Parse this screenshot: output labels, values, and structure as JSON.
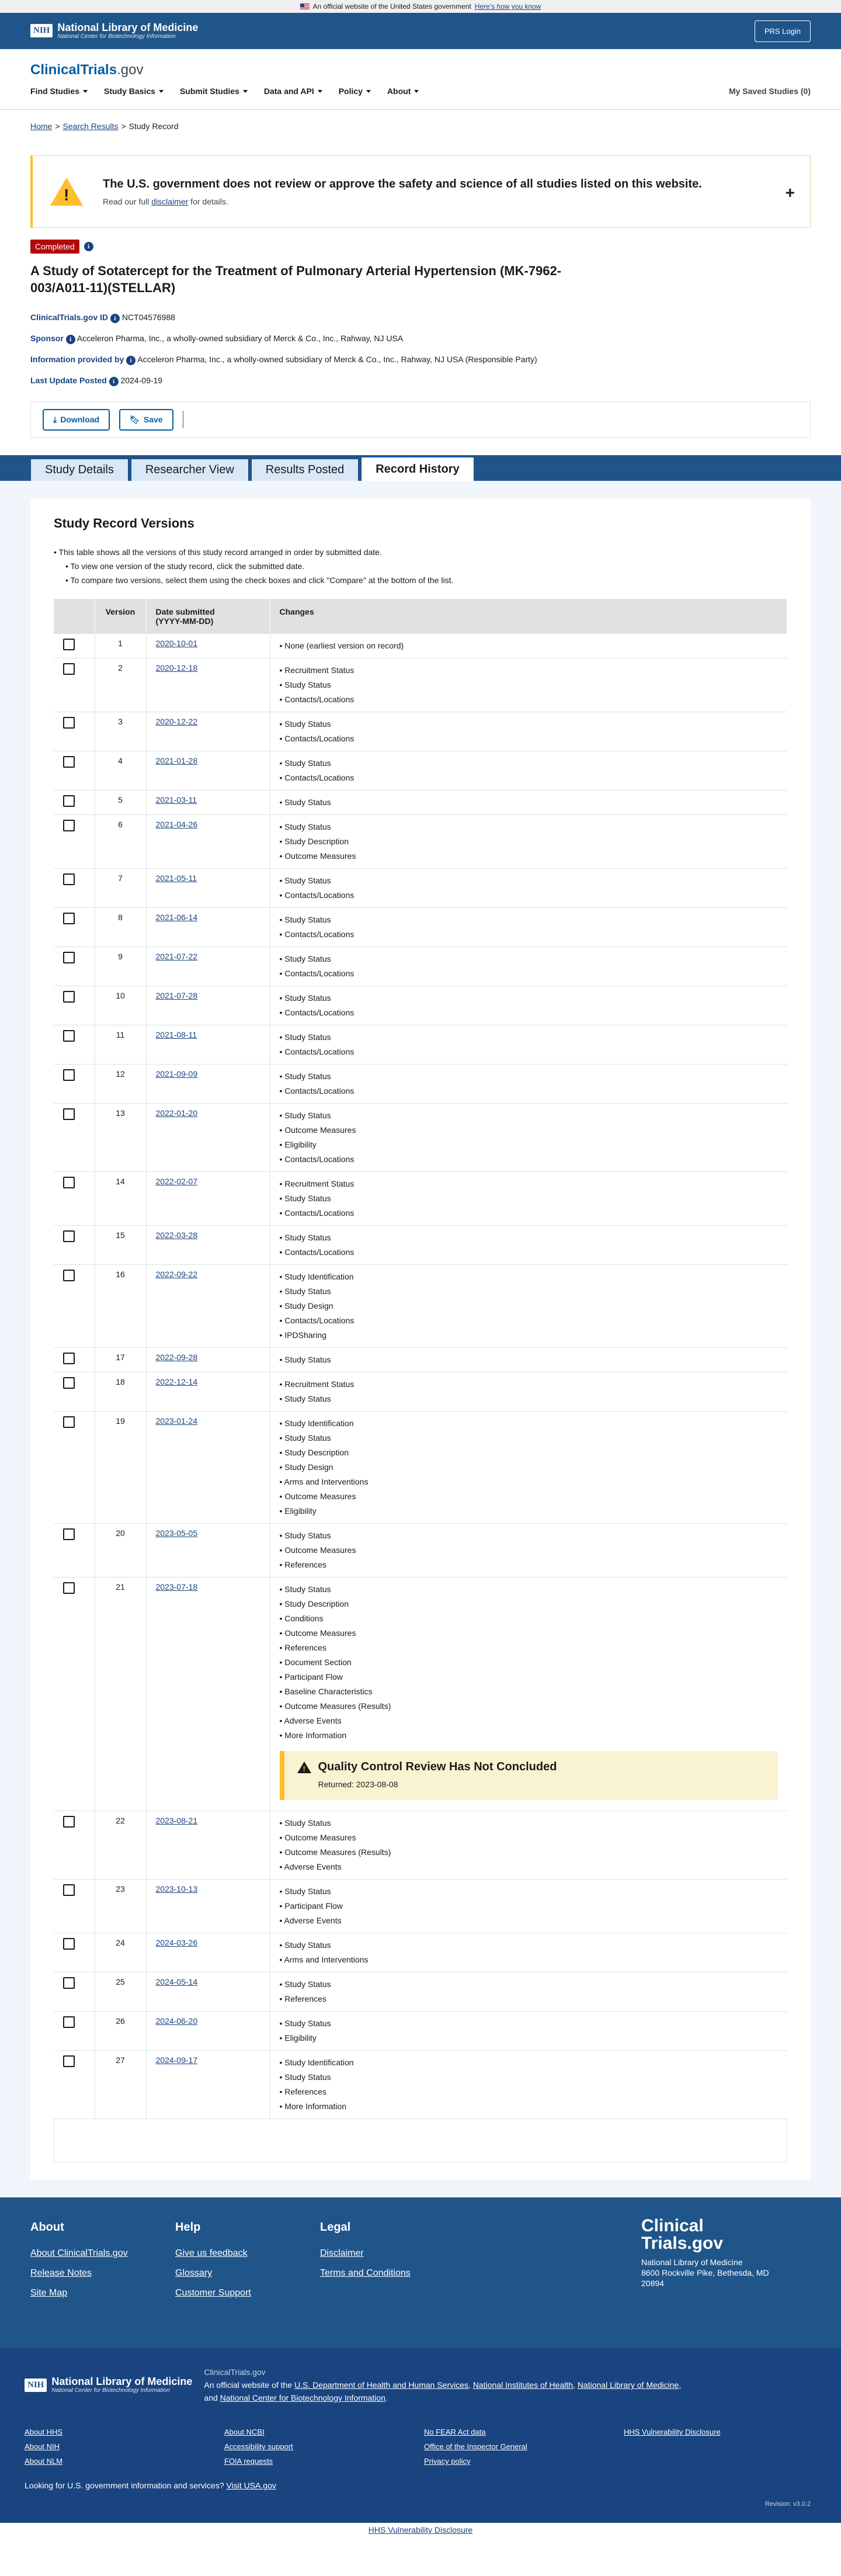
{
  "gov_banner": {
    "text": "An official website of the United States government",
    "link": "Here's how you know"
  },
  "nlm_header": {
    "title": "National Library of Medicine",
    "subtitle": "National Center for Biotechnology Information",
    "prs_login": "PRS Login"
  },
  "site": {
    "logo_main": "ClinicalTrials",
    "logo_suffix": ".gov"
  },
  "nav": {
    "items": [
      "Find Studies",
      "Study Basics",
      "Submit Studies",
      "Data and API",
      "Policy",
      "About"
    ],
    "saved": "My Saved Studies (0)"
  },
  "breadcrumb": {
    "home": "Home",
    "search": "Search Results",
    "current": "Study Record"
  },
  "alert": {
    "title": "The U.S. government does not review or approve the safety and science of all studies listed on this website.",
    "pre": "Read our full ",
    "link": "disclaimer",
    "post": " for details."
  },
  "study": {
    "status": "Completed",
    "title": "A Study of Sotatercept for the Treatment of Pulmonary Arterial Hypertension (MK-7962-003/A011-11)(STELLAR)",
    "id_label": "ClinicalTrials.gov ID",
    "id": "NCT04576988",
    "sponsor_label": "Sponsor",
    "sponsor": "Acceleron Pharma, Inc., a wholly-owned subsidiary of Merck & Co., Inc., Rahway, NJ USA",
    "info_label": "Information provided by",
    "info": "Acceleron Pharma, Inc., a wholly-owned subsidiary of Merck & Co., Inc., Rahway, NJ USA (Responsible Party)",
    "update_label": "Last Update Posted",
    "update": "2024-09-19"
  },
  "actions": {
    "download": "Download",
    "save": "Save"
  },
  "tabs": [
    "Study Details",
    "Researcher View",
    "Results Posted",
    "Record History"
  ],
  "versions": {
    "title": "Study Record Versions",
    "instructions": [
      "This table shows all the versions of this study record arranged in order by submitted date.",
      "To view one version of the study record, click the submitted date.",
      "To compare two versions, select them using the check boxes and click \"Compare\" at the bottom of the list."
    ],
    "headers": {
      "version": "Version",
      "date": "Date submitted",
      "date_format": "(YYYY-MM-DD)",
      "changes": "Changes"
    },
    "qc": {
      "title": "Quality Control Review Has Not Concluded",
      "returned": "Returned: 2023-08-08"
    },
    "rows": [
      {
        "v": "1",
        "date": "2020-10-01",
        "changes": [
          "None (earliest version on record)"
        ]
      },
      {
        "v": "2",
        "date": "2020-12-18",
        "changes": [
          "Recruitment Status",
          "Study Status",
          "Contacts/Locations"
        ]
      },
      {
        "v": "3",
        "date": "2020-12-22",
        "changes": [
          "Study Status",
          "Contacts/Locations"
        ]
      },
      {
        "v": "4",
        "date": "2021-01-28",
        "changes": [
          "Study Status",
          "Contacts/Locations"
        ]
      },
      {
        "v": "5",
        "date": "2021-03-11",
        "changes": [
          "Study Status"
        ]
      },
      {
        "v": "6",
        "date": "2021-04-26",
        "changes": [
          "Study Status",
          "Study Description",
          "Outcome Measures"
        ]
      },
      {
        "v": "7",
        "date": "2021-05-11",
        "changes": [
          "Study Status",
          "Contacts/Locations"
        ]
      },
      {
        "v": "8",
        "date": "2021-06-14",
        "changes": [
          "Study Status",
          "Contacts/Locations"
        ]
      },
      {
        "v": "9",
        "date": "2021-07-22",
        "changes": [
          "Study Status",
          "Contacts/Locations"
        ]
      },
      {
        "v": "10",
        "date": "2021-07-28",
        "changes": [
          "Study Status",
          "Contacts/Locations"
        ]
      },
      {
        "v": "11",
        "date": "2021-08-11",
        "changes": [
          "Study Status",
          "Contacts/Locations"
        ]
      },
      {
        "v": "12",
        "date": "2021-09-09",
        "changes": [
          "Study Status",
          "Contacts/Locations"
        ]
      },
      {
        "v": "13",
        "date": "2022-01-20",
        "changes": [
          "Study Status",
          "Outcome Measures",
          "Eligibility",
          "Contacts/Locations"
        ]
      },
      {
        "v": "14",
        "date": "2022-02-07",
        "changes": [
          "Recruitment Status",
          "Study Status",
          "Contacts/Locations"
        ]
      },
      {
        "v": "15",
        "date": "2022-03-28",
        "changes": [
          "Study Status",
          "Contacts/Locations"
        ]
      },
      {
        "v": "16",
        "date": "2022-09-22",
        "changes": [
          "Study Identification",
          "Study Status",
          "Study Design",
          "Contacts/Locations",
          "IPDSharing"
        ]
      },
      {
        "v": "17",
        "date": "2022-09-28",
        "changes": [
          "Study Status"
        ]
      },
      {
        "v": "18",
        "date": "2022-12-14",
        "changes": [
          "Recruitment Status",
          "Study Status"
        ]
      },
      {
        "v": "19",
        "date": "2023-01-24",
        "changes": [
          "Study Identification",
          "Study Status",
          "Study Description",
          "Study Design",
          "Arms and Interventions",
          "Outcome Measures",
          "Eligibility"
        ]
      },
      {
        "v": "20",
        "date": "2023-05-05",
        "changes": [
          "Study Status",
          "Outcome Measures",
          "References"
        ]
      },
      {
        "v": "21",
        "date": "2023-07-18",
        "changes": [
          "Study Status",
          "Study Description",
          "Conditions",
          "Outcome Measures",
          "References",
          "Document Section",
          "Participant Flow",
          "Baseline Characteristics",
          "Outcome Measures (Results)",
          "Adverse Events",
          "More Information"
        ],
        "qc": true
      },
      {
        "v": "22",
        "date": "2023-08-21",
        "changes": [
          "Study Status",
          "Outcome Measures",
          "Outcome Measures (Results)",
          "Adverse Events"
        ]
      },
      {
        "v": "23",
        "date": "2023-10-13",
        "changes": [
          "Study Status",
          "Participant Flow",
          "Adverse Events"
        ]
      },
      {
        "v": "24",
        "date": "2024-03-26",
        "changes": [
          "Study Status",
          "Arms and Interventions"
        ]
      },
      {
        "v": "25",
        "date": "2024-05-14",
        "changes": [
          "Study Status",
          "References"
        ]
      },
      {
        "v": "26",
        "date": "2024-06-20",
        "changes": [
          "Study Status",
          "Eligibility"
        ]
      },
      {
        "v": "27",
        "date": "2024-09-17",
        "changes": [
          "Study Identification",
          "Study Status",
          "References",
          "More Information"
        ]
      }
    ]
  },
  "footer": {
    "about": {
      "title": "About",
      "links": [
        "About ClinicalTrials.gov",
        "Release Notes",
        "Site Map"
      ]
    },
    "help": {
      "title": "Help",
      "links": [
        "Give us feedback",
        "Glossary",
        "Customer Support"
      ]
    },
    "legal": {
      "title": "Legal",
      "links": [
        "Disclaimer",
        "Terms and Conditions"
      ]
    },
    "brand": {
      "line1": "Clinical",
      "line2": "Trials.gov",
      "org": "National Library of Medicine",
      "addr1": "8600 Rockville Pike, Bethesda, MD",
      "addr2": "20894"
    }
  },
  "nlm_footer": {
    "site": "ClinicalTrials.gov",
    "pre": "An official website of the ",
    "hhs": "U.S. Department of Health and Human Services",
    "nih": "National Institutes of Health",
    "nlm": "National Library of Medicine",
    "and": "and ",
    "ncbi": "National Center for Biotechnology Information",
    "links": [
      "About HHS",
      "About NCBI",
      "No FEAR Act data",
      "HHS Vulnerability Disclosure",
      "About NIH",
      "Accessibility support",
      "Office of the Inspector General",
      "",
      "About NLM",
      "FOIA requests",
      "Privacy policy",
      ""
    ],
    "usa_pre": "Looking for U.S. government information and services?",
    "usa_link": "Visit USA.gov",
    "revision": "Revision: v3.0.2"
  },
  "bottom_link": "HHS Vulnerability Disclosure"
}
